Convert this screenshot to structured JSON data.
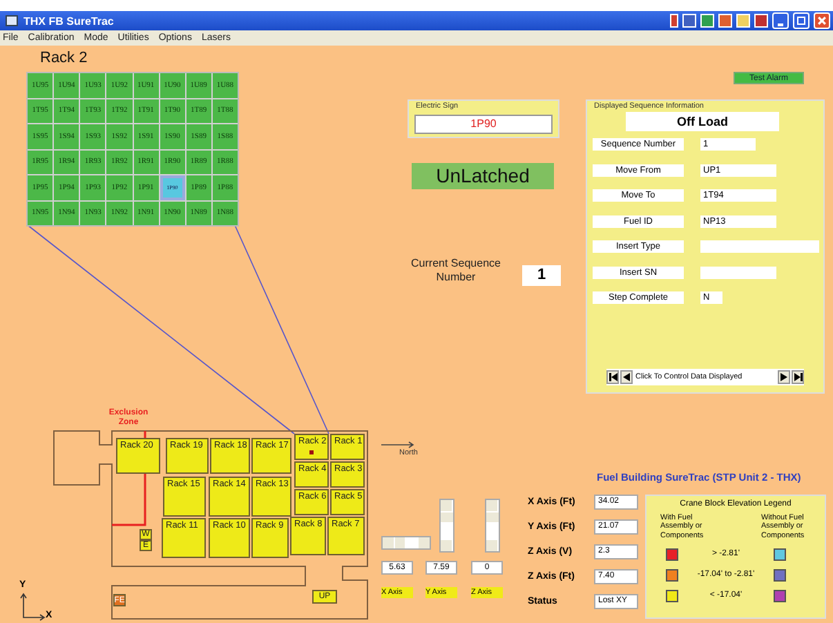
{
  "window": {
    "title": "THX FB SureTrac"
  },
  "menu": [
    "File",
    "Calibration",
    "Mode",
    "Utilities",
    "Options",
    "Lasers"
  ],
  "rack_view": {
    "title": "Rack 2",
    "rows": [
      [
        {
          "label": "1U95",
          "selected": false
        },
        {
          "label": "1U94",
          "selected": false
        },
        {
          "label": "1U93",
          "selected": false
        },
        {
          "label": "1U92",
          "selected": false
        },
        {
          "label": "1U91",
          "selected": false
        },
        {
          "label": "1U90",
          "selected": false
        },
        {
          "label": "1U89",
          "selected": false
        },
        {
          "label": "1U88",
          "selected": false
        }
      ],
      [
        {
          "label": "1T95",
          "selected": false
        },
        {
          "label": "1T94",
          "selected": false
        },
        {
          "label": "1T93",
          "selected": false
        },
        {
          "label": "1T92",
          "selected": false
        },
        {
          "label": "1T91",
          "selected": false
        },
        {
          "label": "1T90",
          "selected": false
        },
        {
          "label": "1T89",
          "selected": false
        },
        {
          "label": "1T88",
          "selected": false
        }
      ],
      [
        {
          "label": "1S95",
          "selected": false
        },
        {
          "label": "1S94",
          "selected": false
        },
        {
          "label": "1S93",
          "selected": false
        },
        {
          "label": "1S92",
          "selected": false
        },
        {
          "label": "1S91",
          "selected": false
        },
        {
          "label": "1S90",
          "selected": false
        },
        {
          "label": "1S89",
          "selected": false
        },
        {
          "label": "1S88",
          "selected": false
        }
      ],
      [
        {
          "label": "1R95",
          "selected": false
        },
        {
          "label": "1R94",
          "selected": false
        },
        {
          "label": "1R93",
          "selected": false
        },
        {
          "label": "1R92",
          "selected": false
        },
        {
          "label": "1R91",
          "selected": false
        },
        {
          "label": "1R90",
          "selected": false
        },
        {
          "label": "1R89",
          "selected": false
        },
        {
          "label": "1R88",
          "selected": false
        }
      ],
      [
        {
          "label": "1P95",
          "selected": false
        },
        {
          "label": "1P94",
          "selected": false
        },
        {
          "label": "1P93",
          "selected": false
        },
        {
          "label": "1P92",
          "selected": false
        },
        {
          "label": "1P91",
          "selected": false
        },
        {
          "label": "1P90",
          "selected": true
        },
        {
          "label": "1P89",
          "selected": false
        },
        {
          "label": "1P88",
          "selected": false
        }
      ],
      [
        {
          "label": "1N95",
          "selected": false
        },
        {
          "label": "1N94",
          "selected": false
        },
        {
          "label": "1N93",
          "selected": false
        },
        {
          "label": "1N92",
          "selected": false
        },
        {
          "label": "1N91",
          "selected": false
        },
        {
          "label": "1N90",
          "selected": false
        },
        {
          "label": "1N89",
          "selected": false
        },
        {
          "label": "1N88",
          "selected": false
        }
      ]
    ]
  },
  "test_alarm": "Test Alarm",
  "electric_sign": {
    "title": "Electric Sign",
    "value": "1P90"
  },
  "latch_status": "UnLatched",
  "current_sequence": {
    "label": "Current Sequence Number",
    "value": "1"
  },
  "sequence_info": {
    "title": "Displayed Sequence Information",
    "operation": "Off Load",
    "fields": [
      {
        "label": "Sequence Number",
        "value": "1"
      },
      {
        "label": "Move From",
        "value": "UP1"
      },
      {
        "label": "Move To",
        "value": "1T94"
      },
      {
        "label": "Fuel ID",
        "value": "NP13"
      },
      {
        "label": "Insert Type"
      },
      {
        "label": "Insert SN"
      },
      {
        "label": "Step Complete",
        "value": "N"
      }
    ],
    "nav_text": "Click To Control Data Displayed"
  },
  "map": {
    "exclusion_label": "Exclusion Zone",
    "north_label": "North",
    "racks": [
      {
        "label": "Rack 20",
        "selected": false
      },
      {
        "label": "Rack 19",
        "selected": false
      },
      {
        "label": "Rack 18",
        "selected": false
      },
      {
        "label": "Rack 17",
        "selected": false
      },
      {
        "label": "Rack 2",
        "selected": true
      },
      {
        "label": "Rack 1",
        "selected": false
      },
      {
        "label": "Rack 4",
        "selected": false
      },
      {
        "label": "Rack 3",
        "selected": false
      },
      {
        "label": "Rack 15",
        "selected": false
      },
      {
        "label": "Rack 14",
        "selected": false
      },
      {
        "label": "Rack 13",
        "selected": false
      },
      {
        "label": "Rack 6",
        "selected": false
      },
      {
        "label": "Rack 5",
        "selected": false
      },
      {
        "label": "Rack 11",
        "selected": false
      },
      {
        "label": "Rack 10",
        "selected": false
      },
      {
        "label": "Rack 9",
        "selected": false
      },
      {
        "label": "Rack 8",
        "selected": false
      },
      {
        "label": "Rack 7",
        "selected": false
      }
    ],
    "markers": [
      "W",
      "E",
      "FE",
      "UP"
    ],
    "axes": {
      "y": "Y",
      "x": "X"
    }
  },
  "scrollers": [
    {
      "kind": "horizontal",
      "value": "5.63",
      "label": "X Axis"
    },
    {
      "kind": "vertical",
      "value": "7.59",
      "label": "Y Axis"
    },
    {
      "kind": "vertical",
      "value": "0",
      "label": "Z Axis"
    }
  ],
  "app_title": "Fuel Building SureTrac (STP Unit 2 - THX)",
  "readouts": [
    {
      "label": "X Axis (Ft)",
      "value": "34.02"
    },
    {
      "label": "Y Axis (Ft)",
      "value": "21.07"
    },
    {
      "label": "Z Axis (V)",
      "value": "2.3"
    },
    {
      "label": "Z Axis (Ft)",
      "value": "7.40"
    },
    {
      "label": "Status",
      "value": "Lost XY"
    }
  ],
  "legend": {
    "title": "Crane Block Elevation Legend",
    "with_header": "With Fuel Assembly or Components",
    "without_header": "Without Fuel Assembly or Components",
    "rows": [
      {
        "range": "> -2.81'",
        "swatches": [
          {
            "color": "#e82028"
          },
          {
            "color": "#60c8e0"
          }
        ]
      },
      {
        "range": "-17.04' to -2.81'",
        "swatches": [
          {
            "color": "#f08020"
          },
          {
            "color": "#7070c0"
          }
        ]
      },
      {
        "range": "< -17.04'",
        "swatches": [
          {
            "color": "#f0e818"
          },
          {
            "color": "#b040b0"
          }
        ]
      }
    ]
  }
}
